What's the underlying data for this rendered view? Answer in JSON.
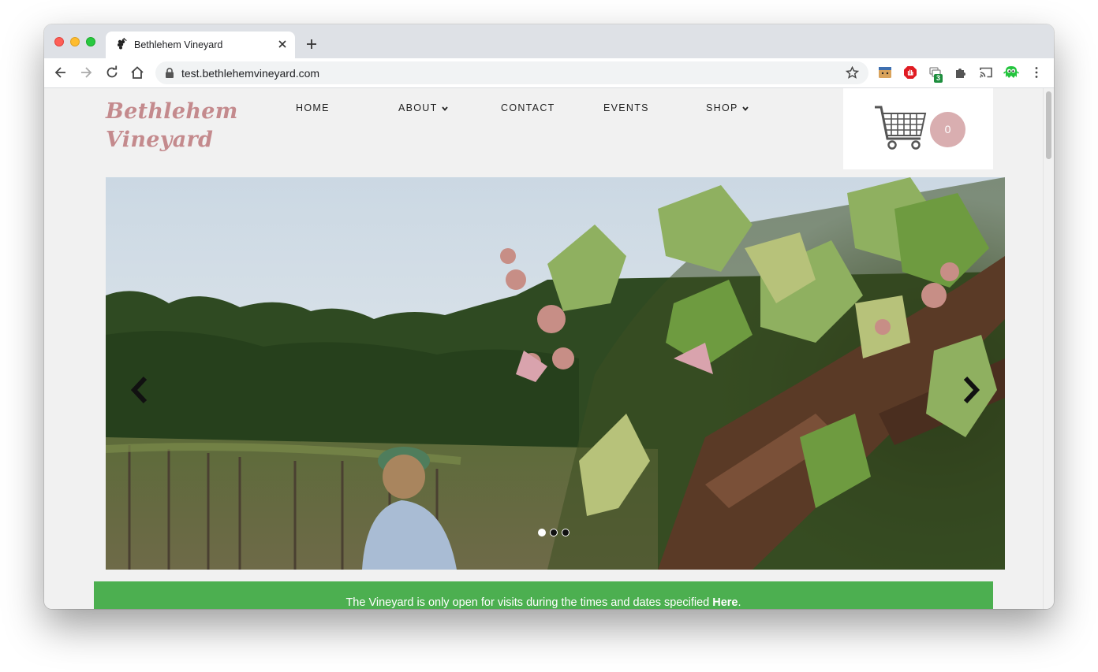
{
  "browser": {
    "tab_title": "Bethlehem Vineyard",
    "url": "test.bethlehemvineyard.com",
    "extension_badge": "3"
  },
  "site": {
    "logo_line1": "Bethlehem",
    "logo_line2": "Vineyard",
    "nav": {
      "home": "HOME",
      "about": "ABOUT",
      "contact": "CONTACT",
      "events": "EVENTS",
      "shop": "SHOP"
    },
    "cart_count": "0"
  },
  "slider": {
    "slide_count": 3,
    "active_slide": 1
  },
  "notice": {
    "text": "The Vineyard is only open for visits during the times and dates specified ",
    "link": "Here",
    "end": "."
  },
  "colors": {
    "logo": "#c48a8d",
    "cart_badge": "#d9aeb0",
    "notice_bg": "#4caf50",
    "page_bg": "#f1f1f1"
  }
}
